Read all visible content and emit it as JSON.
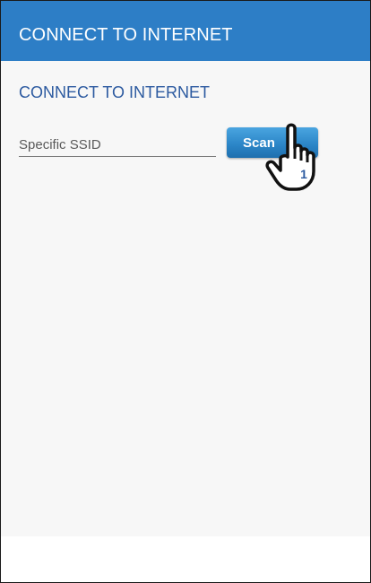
{
  "app_bar": {
    "title": "CONNECT TO INTERNET"
  },
  "main": {
    "section_title": "CONNECT TO INTERNET",
    "ssid_input": {
      "value": "",
      "placeholder": "Specific SSID"
    },
    "scan_button": {
      "label": "Scan"
    }
  },
  "annotation": {
    "step_number": "1",
    "icon": "hand-pointer-icon"
  },
  "colors": {
    "app_bar": "#2d7ec6",
    "section_title": "#2c5aa0",
    "scan_button": "#2a84c6",
    "content_background": "#f7f7f7"
  }
}
